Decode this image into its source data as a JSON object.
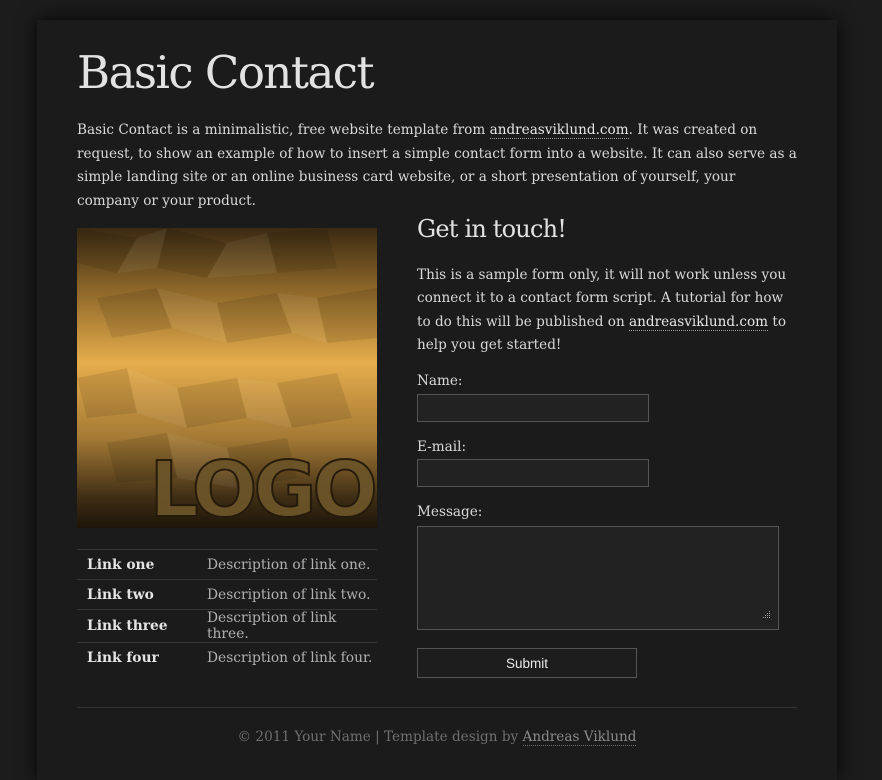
{
  "page": {
    "title": "Basic Contact",
    "intro": {
      "before_link": "Basic Contact is a minimalistic, free website template from ",
      "link": "andreasviklund.com",
      "after_link": ". It was created on request, to show an example of how to insert a simple contact form into a website. It can also serve as a simple landing site or an online business card website, or a short presentation of yourself, your company or your product."
    }
  },
  "logo": {
    "text": "LOGO"
  },
  "links": [
    {
      "name": "Link one",
      "description": "Description of link one."
    },
    {
      "name": "Link two",
      "description": "Description of link two."
    },
    {
      "name": "Link three",
      "description": "Description of link three."
    },
    {
      "name": "Link four",
      "description": "Description of link four."
    }
  ],
  "contact": {
    "heading": "Get in touch!",
    "text_before_link": "This is a sample form only, it will not work unless you connect it to a contact form script. A tutorial for how to do this will be published on ",
    "text_link": "andreasviklund.com",
    "text_after_link": " to help you get started!",
    "form": {
      "name_label": "Name:",
      "name_value": "",
      "email_label": "E-mail:",
      "email_value": "",
      "message_label": "Message:",
      "message_value": "",
      "submit_label": "Submit"
    }
  },
  "footer": {
    "text": "© 2011 Your Name | Template design by ",
    "link": "Andreas Viklund"
  },
  "colors": {
    "background": "#1c1c1c",
    "container": "#1b1b1b",
    "text": "#d8d8d8",
    "input_background": "#222222",
    "input_border": "#555555",
    "logo_gold": "#e6ad4c"
  }
}
